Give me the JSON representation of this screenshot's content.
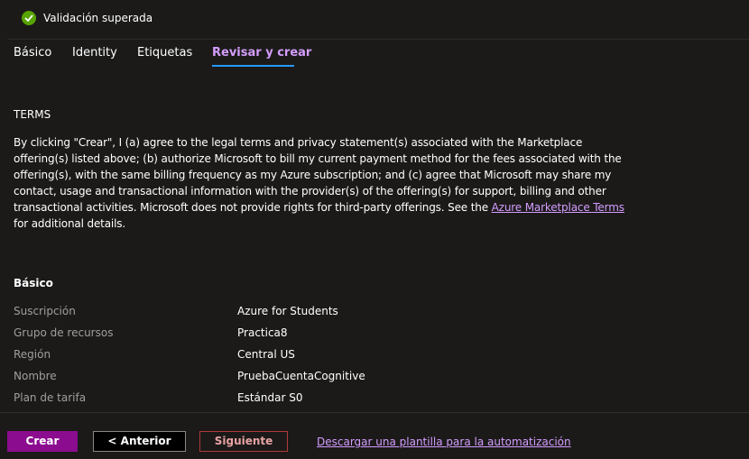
{
  "validation": {
    "status_text": "Validación superada",
    "icon": "checkmark-circle-icon",
    "color": "#57a300"
  },
  "tabs": [
    {
      "label": "Básico"
    },
    {
      "label": "Identity"
    },
    {
      "label": "Etiquetas"
    },
    {
      "label": "Revisar y crear",
      "active": true
    }
  ],
  "terms": {
    "heading": "TERMS",
    "body_text": "By clicking \"Crear\", I (a) agree to the legal terms and privacy statement(s) associated with the Marketplace offering(s) listed above; (b) authorize Microsoft to bill my current payment method for the fees associated with the offering(s), with the same billing frequency as my Azure subscription; and (c) agree that Microsoft may share my contact, usage and transactional information with the provider(s) of the offering(s) for support, billing and other transactional activities. Microsoft does not provide rights for third-party offerings. See the ",
    "link_text": "Azure Marketplace Terms",
    "body_suffix": " for additional details."
  },
  "summary": {
    "section_title": "Básico",
    "rows": [
      {
        "label": "Suscripción",
        "value": "Azure for Students"
      },
      {
        "label": "Grupo de recursos",
        "value": "Practica8"
      },
      {
        "label": "Región",
        "value": "Central US"
      },
      {
        "label": "Nombre",
        "value": "PruebaCuentaCognitive"
      },
      {
        "label": "Plan de tarifa",
        "value": "Estándar S0"
      }
    ]
  },
  "footer": {
    "create_label": "Crear",
    "previous_label": "< Anterior",
    "next_label": "Siguiente",
    "download_link": "Descargar una plantilla para la automatización"
  },
  "colors": {
    "background": "#1b1a19",
    "accent_purple": "#8b0c8f",
    "link_purple": "#d59dff",
    "tab_underline": "#2899f5",
    "label_gray": "#a19f9d"
  }
}
